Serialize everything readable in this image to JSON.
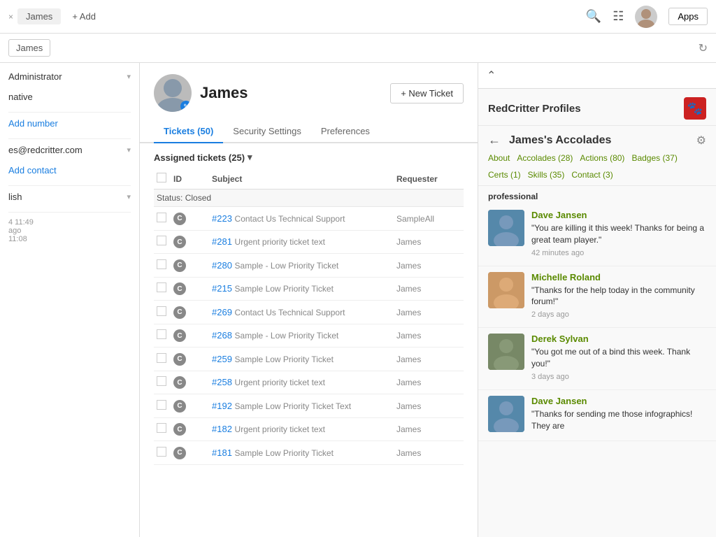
{
  "topbar": {
    "tab_close": "×",
    "tab_label": "James",
    "add_label": "+ Add",
    "apps_label": "Apps"
  },
  "subnav": {
    "breadcrumb_label": "James"
  },
  "sidebar": {
    "role_label": "Administrator",
    "role_dropdown": "▾",
    "type_label": "native",
    "phone_placeholder": "Add number",
    "email_label": "es@redcritter.com",
    "email_dropdown": "▾",
    "add_contact": "Add contact",
    "language_dropdown": "▾",
    "language_value": "lish",
    "meta1": "4 11:49",
    "meta2": "ago",
    "meta3": "11:08"
  },
  "profile": {
    "name": "James",
    "new_ticket_label": "+ New Ticket",
    "tabs": [
      {
        "label": "Tickets (50)",
        "active": true
      },
      {
        "label": "Security Settings",
        "active": false
      },
      {
        "label": "Preferences",
        "active": false
      }
    ],
    "assigned_header": "Assigned tickets (25)",
    "table": {
      "cols": [
        "",
        "ID",
        "Subject",
        "Requester"
      ],
      "status_group": "Status: Closed",
      "rows": [
        {
          "id": "#223",
          "subject": "Contact Us Technical Support",
          "requester": "SampleAll"
        },
        {
          "id": "#281",
          "subject": "Urgent priority ticket text",
          "requester": "James"
        },
        {
          "id": "#280",
          "subject": "Sample - Low Priority Ticket",
          "requester": "James"
        },
        {
          "id": "#215",
          "subject": "Sample Low Priority Ticket",
          "requester": "James"
        },
        {
          "id": "#269",
          "subject": "Contact Us Technical Support",
          "requester": "James"
        },
        {
          "id": "#268",
          "subject": "Sample - Low Priority Ticket",
          "requester": "James"
        },
        {
          "id": "#259",
          "subject": "Sample Low Priority Ticket",
          "requester": "James"
        },
        {
          "id": "#258",
          "subject": "Urgent priority ticket text",
          "requester": "James"
        },
        {
          "id": "#192",
          "subject": "Sample Low Priority Ticket Text",
          "requester": "James"
        },
        {
          "id": "#182",
          "subject": "Urgent priority ticket text",
          "requester": "James"
        },
        {
          "id": "#181",
          "subject": "Sample Low Priority Ticket",
          "requester": "James"
        }
      ]
    }
  },
  "redcritter": {
    "title": "RedCritter Profiles",
    "logo_icon": "🐾",
    "accolades_title": "James's Accolades",
    "nav_links": [
      {
        "label": "About"
      },
      {
        "label": "Accolades (28)"
      },
      {
        "label": "Actions (80)"
      },
      {
        "label": "Badges (37)"
      },
      {
        "label": "Certs (1)"
      },
      {
        "label": "Skills (35)"
      },
      {
        "label": "Contact (3)"
      }
    ],
    "section_label": "professional",
    "accolades": [
      {
        "name": "Dave Jansen",
        "quote": "\"You are killing it this week! Thanks for being a great team player.\"",
        "time": "42 minutes ago",
        "avatar_color": "#5588aa"
      },
      {
        "name": "Michelle Roland",
        "quote": "\"Thanks for the help today in the community forum!\"",
        "time": "2 days ago",
        "avatar_color": "#cc9966"
      },
      {
        "name": "Derek Sylvan",
        "quote": "\"You got me out of a bind this week. Thank you!\"",
        "time": "3 days ago",
        "avatar_color": "#778866"
      },
      {
        "name": "Dave Jansen",
        "quote": "\"Thanks for sending me those infographics! They are",
        "time": "",
        "avatar_color": "#5588aa"
      }
    ]
  }
}
